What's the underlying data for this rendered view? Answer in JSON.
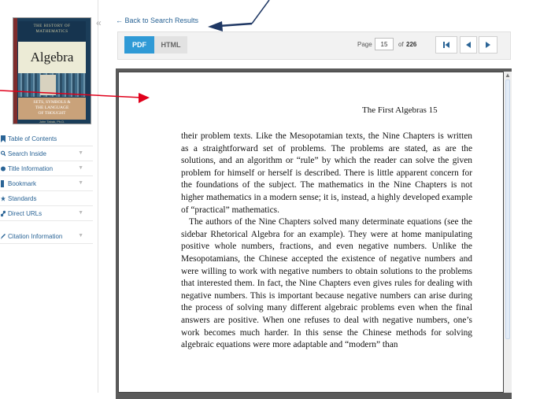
{
  "book": {
    "series_line1": "THE HISTORY OF",
    "series_line2": "MATHEMATICS",
    "title": "Algebra",
    "subtitle_line1": "SETS, SYMBOLS &",
    "subtitle_line2": "THE LANGUAGE",
    "subtitle_line3": "OF THOUGHT",
    "author": "John Tabak, Ph.D."
  },
  "sidebar": {
    "items": [
      {
        "label": "Table of Contents",
        "chevron": ""
      },
      {
        "label": "Search Inside",
        "chevron": "▼"
      },
      {
        "label": "Title Information",
        "chevron": "▼"
      },
      {
        "label": "Bookmark",
        "chevron": "▼"
      },
      {
        "label": "Standards",
        "chevron": ""
      },
      {
        "label": "Direct URLs",
        "chevron": "▼"
      },
      {
        "label": "Citation Information",
        "chevron": "▼"
      }
    ],
    "collapse": "«"
  },
  "back_link": "← Back to Search Results",
  "toolbar": {
    "pdf_label": "PDF",
    "html_label": "HTML",
    "page_label": "Page",
    "page_value": "15",
    "of_label": "of",
    "total_pages": "226",
    "first_icon": "⏮",
    "prev_icon": "◀",
    "next_icon": "▶"
  },
  "document": {
    "running_head": "The First Algebras  15",
    "paragraph1": "their problem texts. Like the Mesopotamian texts, the Nine Chapters is written as a straightforward set of problems. The problems are stated, as are the solutions, and an algorithm or “rule” by which the reader can solve the given problem for himself or herself is described. There is little apparent concern for the foundations of the subject. The mathematics in the Nine Chapters is not higher mathematics in a modern sense; it is, instead, a highly developed example of “practical” mathematics.",
    "paragraph2": "The authors of the Nine Chapters solved many determinate equations (see the sidebar Rhetorical Algebra for an example). They were at home manipulating positive whole numbers, fractions, and even negative numbers. Unlike the Mesopotamians, the Chinese accepted the existence of negative numbers and were willing to work with negative numbers to obtain solutions to the problems that interested them. In fact, the Nine Chapters even gives rules for dealing with negative numbers. This is important because negative numbers can arise during the process of solving many different algebraic problems even when the final answers are positive. When one refuses to deal with negative numbers, one’s work becomes much harder. In this sense the Chinese methods for solving algebraic equations were more adaptable and “modern” than"
  },
  "colors": {
    "accent": "#2f9ad6",
    "link": "#2a6496",
    "arrow_red": "#e0001b",
    "arrow_navy": "#1f3864"
  }
}
